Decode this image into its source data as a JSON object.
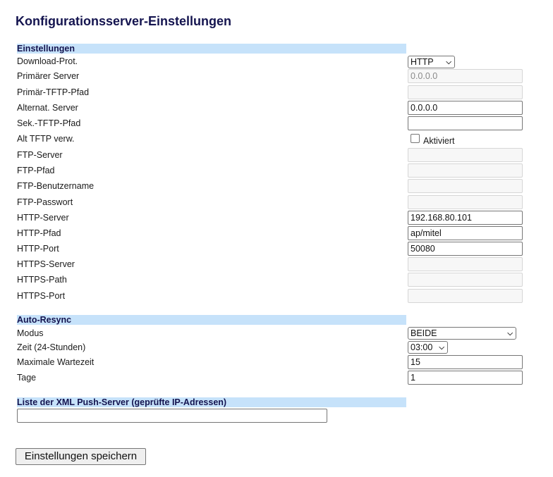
{
  "page": {
    "title": "Konfigurationsserver-Einstellungen"
  },
  "settings": {
    "header": "Einstellungen",
    "download_prot": {
      "label": "Download-Prot.",
      "value": "HTTP"
    },
    "primary_server": {
      "label": "Primärer Server",
      "value": "0.0.0.0"
    },
    "primary_tftp_path": {
      "label": "Primär-TFTP-Pfad",
      "value": ""
    },
    "alt_server": {
      "label": "Alternat. Server",
      "value": "0.0.0.0"
    },
    "sec_tftp_path": {
      "label": "Sek.-TFTP-Pfad",
      "value": ""
    },
    "alt_tftp": {
      "label": "Alt TFTP verw.",
      "checkbox_label": "Aktiviert",
      "checked": false
    },
    "ftp_server": {
      "label": "FTP-Server",
      "value": ""
    },
    "ftp_path": {
      "label": "FTP-Pfad",
      "value": ""
    },
    "ftp_user": {
      "label": "FTP-Benutzername",
      "value": ""
    },
    "ftp_password": {
      "label": "FTP-Passwort",
      "value": ""
    },
    "http_server": {
      "label": "HTTP-Server",
      "value": "192.168.80.101"
    },
    "http_path": {
      "label": "HTTP-Pfad",
      "value": "ap/mitel"
    },
    "http_port": {
      "label": "HTTP-Port",
      "value": "50080"
    },
    "https_server": {
      "label": "HTTPS-Server",
      "value": ""
    },
    "https_path": {
      "label": "HTTPS-Path",
      "value": ""
    },
    "https_port": {
      "label": "HTTPS-Port",
      "value": ""
    }
  },
  "resync": {
    "header": "Auto-Resync",
    "mode": {
      "label": "Modus",
      "value": "BEIDE"
    },
    "time": {
      "label": "Zeit (24-Stunden)",
      "value": "03:00"
    },
    "max_wait": {
      "label": "Maximale Wartezeit",
      "value": "15"
    },
    "days": {
      "label": "Tage",
      "value": "1"
    }
  },
  "push": {
    "header": "Liste der XML Push-Server (geprüfte IP-Adressen)",
    "value": ""
  },
  "save_button": "Einstellungen speichern",
  "icons": {
    "dropdown": "chevron-down-icon"
  }
}
